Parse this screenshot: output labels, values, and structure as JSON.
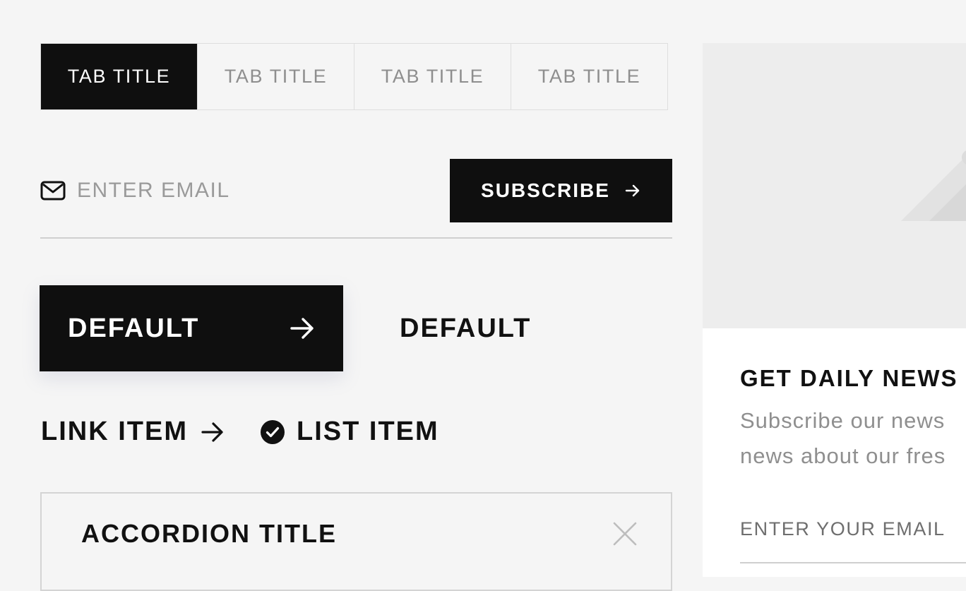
{
  "tabs": [
    {
      "label": "TAB TITLE",
      "active": true
    },
    {
      "label": "TAB TITLE",
      "active": false
    },
    {
      "label": "TAB TITLE",
      "active": false
    },
    {
      "label": "TAB TITLE",
      "active": false
    }
  ],
  "subscribe_form": {
    "email_placeholder": "ENTER EMAIL",
    "email_icon": "mail-icon",
    "button_label": "SUBSCRIBE",
    "button_icon": "arrow-right-icon"
  },
  "buttons": {
    "primary_label": "DEFAULT",
    "primary_icon": "arrow-right-icon",
    "text_label": "DEFAULT"
  },
  "link_item": {
    "label": "LINK ITEM",
    "icon": "arrow-right-icon"
  },
  "list_item": {
    "label": "LIST ITEM",
    "icon": "check-circle-icon"
  },
  "accordion": {
    "title": "ACCORDION TITLE",
    "icon": "close-icon"
  },
  "news_card": {
    "image_icon": "image-placeholder-icon",
    "title": "GET DAILY NEWS",
    "text_lines": [
      "Subscribe our news",
      "news about our fres"
    ],
    "email_placeholder": "ENTER YOUR EMAIL"
  },
  "colors": {
    "background": "#f5f5f5",
    "primary": "#0f0f0f",
    "muted_text": "#8e8e8e",
    "border": "#dedede",
    "card_image_bg": "#ededed"
  }
}
